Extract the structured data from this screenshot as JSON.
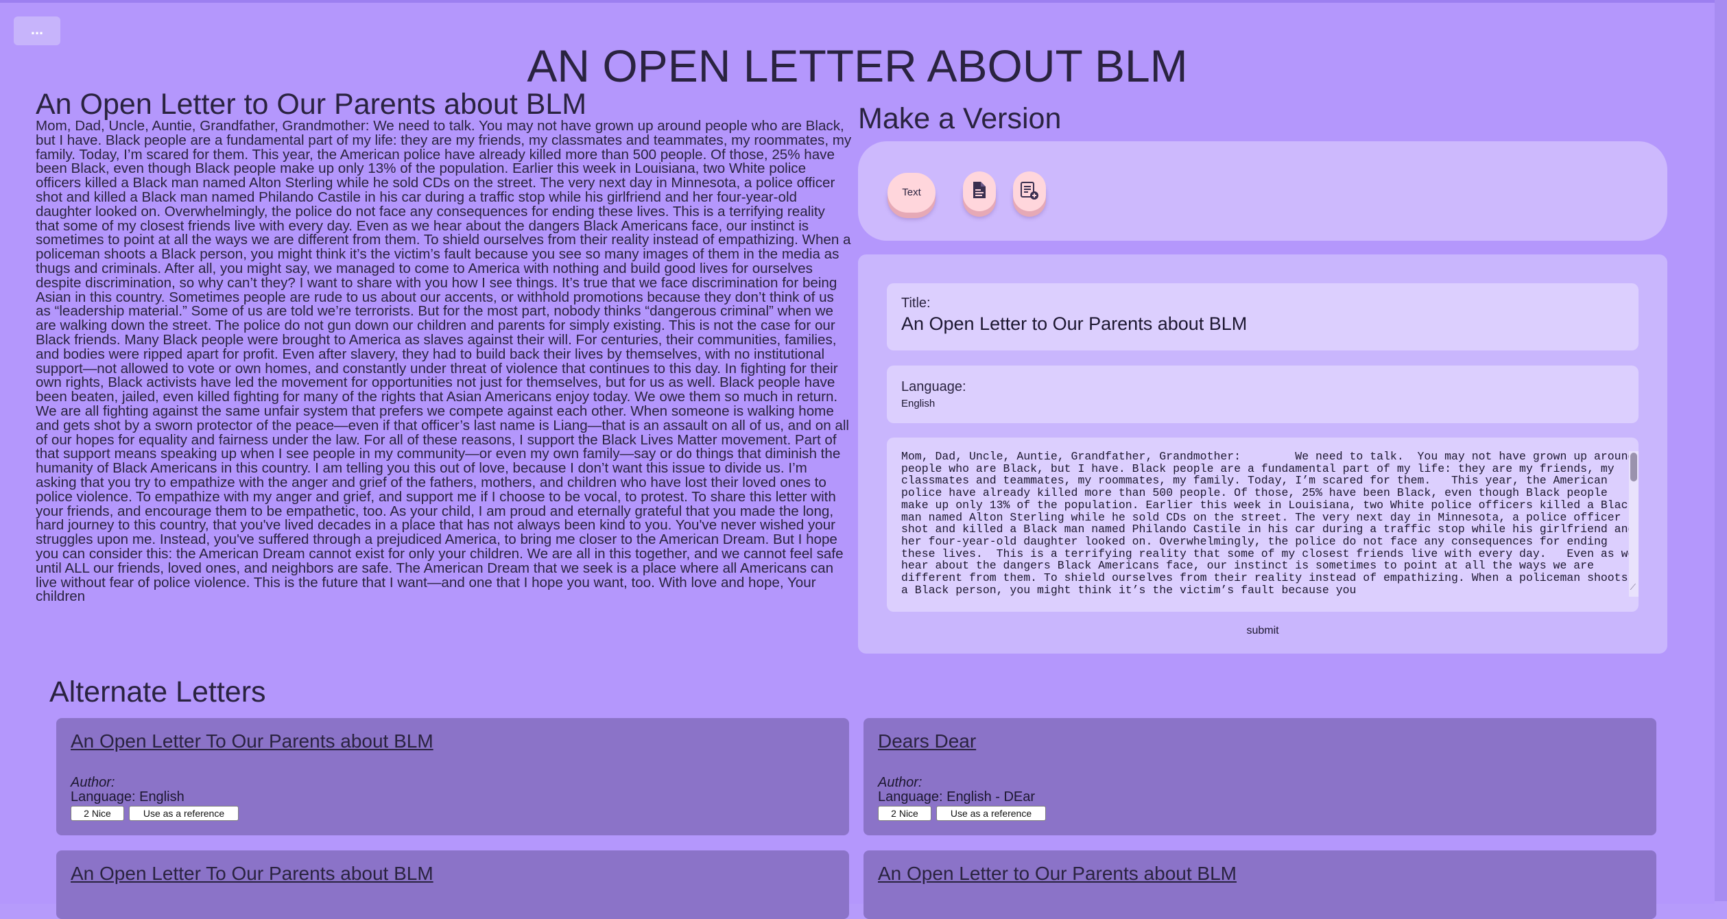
{
  "header": {
    "menu_label": "...",
    "title": "AN OPEN LETTER ABOUT BLM"
  },
  "letter": {
    "title": "An Open Letter to Our Parents about BLM",
    "body": "Mom, Dad, Uncle, Auntie, Grandfather, Grandmother: We need to talk. You may not have grown up around people who are Black, but I have. Black people are a fundamental part of my life: they are my friends, my classmates and teammates, my roommates, my family. Today, I’m scared for them. This year, the American police have already killed more than 500 people. Of those, 25% have been Black, even though Black people make up only 13% of the population. Earlier this week in Louisiana, two White police officers killed a Black man named Alton Sterling while he sold CDs on the street. The very next day in Minnesota, a police officer shot and killed a Black man named Philando Castile in his car during a traffic stop while his girlfriend and her four-year-old daughter looked on. Overwhelmingly, the police do not face any consequences for ending these lives. This is a terrifying reality that some of my closest friends live with every day. Even as we hear about the dangers Black Americans face, our instinct is sometimes to point at all the ways we are different from them. To shield ourselves from their reality instead of empathizing. When a policeman shoots a Black person, you might think it’s the victim’s fault because you see so many images of them in the media as thugs and criminals. After all, you might say, we managed to come to America with nothing and build good lives for ourselves despite discrimination, so why can’t they? I want to share with you how I see things. It’s true that we face discrimination for being Asian in this country. Sometimes people are rude to us about our accents, or withhold promotions because they don’t think of us as “leadership material.” Some of us are told we’re terrorists. But for the most part, nobody thinks “dangerous criminal” when we are walking down the street. The police do not gun down our children and parents for simply existing. This is not the case for our Black friends. Many Black people were brought to America as slaves against their will. For centuries, their communities, families, and bodies were ripped apart for profit. Even after slavery, they had to build back their lives by themselves, with no institutional support—not allowed to vote or own homes, and constantly under threat of violence that continues to this day. In fighting for their own rights, Black activists have led the movement for opportunities not just for themselves, but for us as well. Black people have been beaten, jailed, even killed fighting for many of the rights that Asian Americans enjoy today. We owe them so much in return. We are all fighting against the same unfair system that prefers we compete against each other. When someone is walking home and gets shot by a sworn protector of the peace—even if that officer’s last name is Liang—that is an assault on all of us, and on all of our hopes for equality and fairness under the law. For all of these reasons, I support the Black Lives Matter movement. Part of that support means speaking up when I see people in my community—or even my own family—say or do things that diminish the humanity of Black Americans in this country. I am telling you this out of love, because I don’t want this issue to divide us. I’m asking that you try to empathize with the anger and grief of the fathers, mothers, and children who have lost their loved ones to police violence. To empathize with my anger and grief, and support me if I choose to be vocal, to protest. To share this letter with your friends, and encourage them to be empathetic, too. As your child, I am proud and eternally grateful that you made the long, hard journey to this country, that you've lived decades in a place that has not always been kind to you. You've never wished your struggles upon me. Instead, you've suffered through a prejudiced America, to bring me closer to the American Dream. But I hope you can consider this: the American Dream cannot exist for only your children. We are all in this together, and we cannot feel safe until ALL our friends, loved ones, and neighbors are safe. The American Dream that we seek is a place where all Americans can live without fear of police violence. This is the future that I want—and one that I hope you want, too. With love and hope, Your children"
  },
  "make_version": {
    "heading": "Make a Version",
    "toolbar": {
      "text_button": "Text",
      "icons": [
        "document-icon",
        "list-add-icon"
      ]
    },
    "form": {
      "title_label": "Title:",
      "title_value": "An Open Letter to Our Parents about BLM",
      "language_label": "Language:",
      "language_value": "English",
      "body_value": "Mom, Dad, Uncle, Auntie, Grandfather, Grandmother:        We need to talk.  You may not have grown up around people who are Black, but I have. Black people are a fundamental part of my life: they are my friends, my classmates and teammates, my roommates, my family. Today, I’m scared for them.   This year, the American police have already killed more than 500 people. Of those, 25% have been Black, even though Black people make up only 13% of the population. Earlier this week in Louisiana, two White police officers killed a Black man named Alton Sterling while he sold CDs on the street. The very next day in Minnesota, a police officer shot and killed a Black man named Philando Castile in his car during a traffic stop while his girlfriend and her four-year-old daughter looked on. Overwhelmingly, the police do not face any consequences for ending these lives.  This is a terrifying reality that some of my closest friends live with every day.   Even as we hear about the dangers Black Americans face, our instinct is sometimes to point at all the ways we are different from them. To shield ourselves from their reality instead of empathizing. When a policeman shoots a Black person, you might think it’s the victim’s fault because you",
      "submit_label": "submit"
    }
  },
  "alternates": {
    "heading": "Alternate Letters",
    "cards": [
      {
        "title": "An Open Letter To Our Parents about BLM",
        "author_label": "Author:",
        "language_text": "Language: English",
        "nice_label": "2 Nice",
        "reference_label": "Use as a reference"
      },
      {
        "title": "Dears Dear",
        "author_label": "Author:",
        "language_text": "Language: English - DEar",
        "nice_label": "2 Nice",
        "reference_label": "Use as a reference"
      },
      {
        "title": "An Open Letter To Our Parents about BLM"
      },
      {
        "title": "An Open Letter to Our Parents about BLM"
      }
    ]
  },
  "colors": {
    "background": "#b497fc",
    "card": "#c9b6fd",
    "field": "#dccffe",
    "alt_card": "#8b73c8",
    "pill": "#ffd6dc"
  }
}
